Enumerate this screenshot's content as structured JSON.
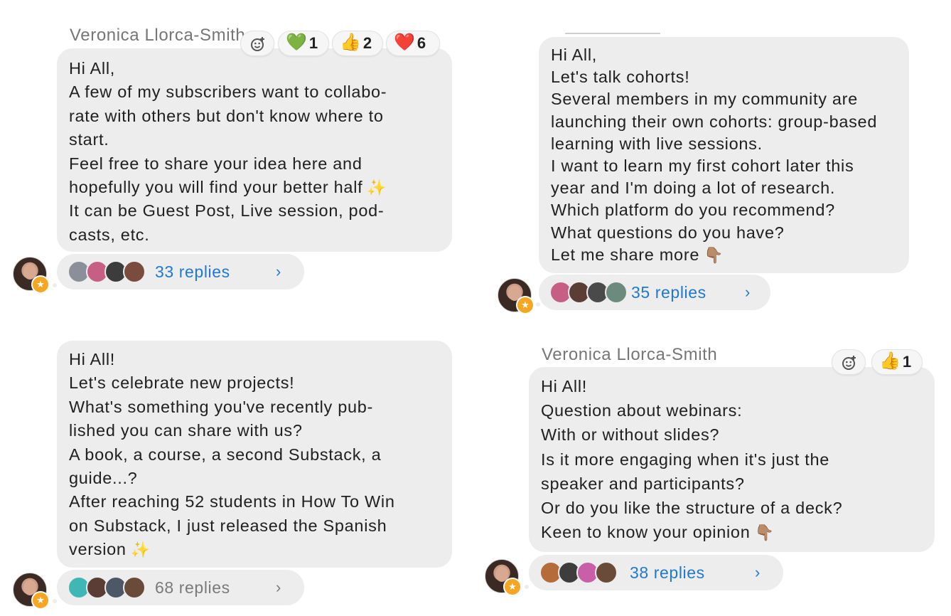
{
  "posts": [
    {
      "sender": "Veronica Llorca-Smith",
      "lines": [
        "Hi All,",
        "A few of my subscribers want to collabo-",
        "rate with others but don't know where to",
        "start.",
        "Feel free to share your idea here and",
        "hopefully you will find your better half",
        "It can be Guest Post, Live session, pod-",
        "casts, etc."
      ],
      "inline_emoji": "✨",
      "reactions": [
        {
          "emoji": "💚",
          "count": "1"
        },
        {
          "emoji": "👍",
          "count": "2"
        },
        {
          "emoji": "❤️",
          "count": "6"
        }
      ],
      "replies": "33 replies"
    },
    {
      "lines": [
        "Hi All,",
        "Let's talk cohorts!",
        "Several members in my community are",
        "launching their own cohorts: group-based",
        "learning with live sessions.",
        "I want to learn my first cohort later this",
        "year and I'm doing a lot of research.",
        "Which platform do you recommend?",
        "What questions do you have?",
        "Let me share more"
      ],
      "inline_emoji": "👇🏽",
      "replies": "35 replies"
    },
    {
      "lines": [
        "Hi All!",
        "Let's celebrate new projects!",
        "What's something you've recently pub-",
        "lished you can share with us?",
        "A book, a course, a second Substack, a",
        "guide...?",
        "After reaching 52 students in How To Win",
        "on Substack, I just released the Spanish",
        "version"
      ],
      "inline_emoji": "✨",
      "replies": "68 replies"
    },
    {
      "sender": "Veronica Llorca-Smith",
      "lines": [
        "Hi All!",
        "Question about webinars:",
        "With or without slides?",
        "Is it more engaging when it's just the",
        "speaker and participants?",
        "Or do you like the structure of a deck?",
        "Keen to know your opinion"
      ],
      "inline_emoji": "👇🏽",
      "reactions": [
        {
          "emoji": "👍",
          "count": "1"
        }
      ],
      "replies": "38 replies"
    }
  ],
  "icons": {
    "add_reaction": "add-reaction-icon",
    "star_badge": "star-badge-icon",
    "chevron": "chevron-right-icon",
    "star_glyph": "★",
    "chevron_glyph": "›"
  },
  "colors": {
    "bubble": "#ededed",
    "link": "#1f78d4",
    "muted": "#7a7a7a",
    "badge": "#f5a623"
  }
}
